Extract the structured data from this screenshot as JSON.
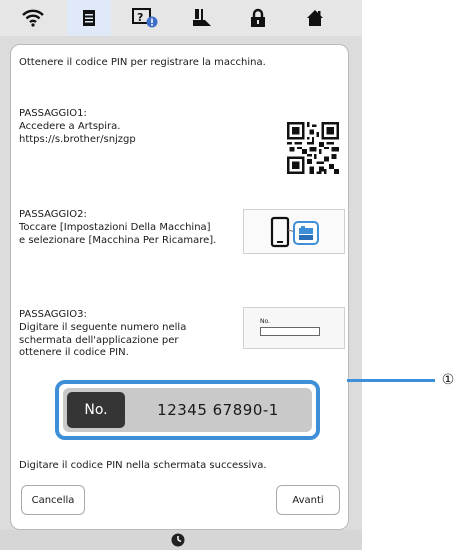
{
  "icons": {
    "tabs": [
      "wifi-icon",
      "document-icon",
      "help-icon",
      "foot-icon",
      "lock-icon",
      "home-icon"
    ],
    "active_tab": "document-icon",
    "accent_color": "#3e8fd8"
  },
  "content": {
    "intro": "Ottenere il codice PIN per registrare la macchina.",
    "step1_title": "PASSAGGIO1:",
    "step1_body": "Accedere a Artspira.\nhttps://s.brother/snjzgp",
    "step2_title": "PASSAGGIO2:",
    "step2_body": "Toccare [Impostazioni Della Macchina] e selezionare [Macchina Per Ricamare].",
    "step3_title": "PASSAGGIO3:",
    "step3_body": "Digitare il seguente numero nella schermata dell'applicazione per ottenere il codice PIN.",
    "no_box_label": "No.",
    "pin_label": "No.",
    "pin_value": "12345 67890-1",
    "bottom_note": "Digitare il codice PIN nella schermata successiva."
  },
  "buttons": {
    "cancel": "Cancella",
    "next": "Avanti"
  },
  "callout": {
    "number": "①"
  }
}
